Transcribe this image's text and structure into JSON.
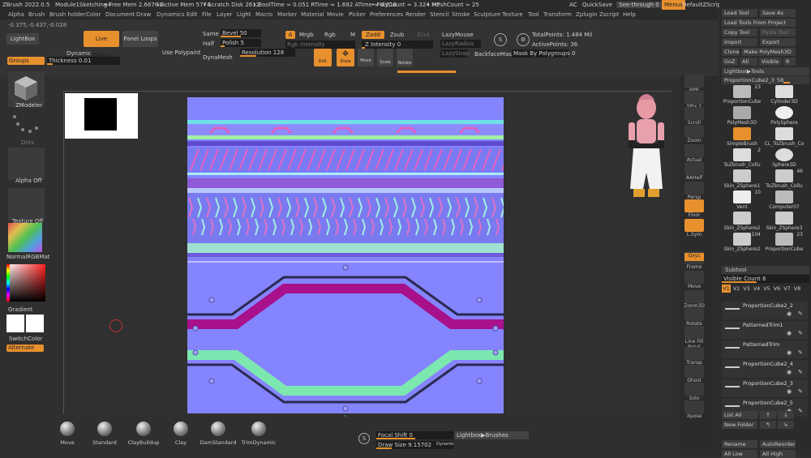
{
  "title": {
    "app": "ZBrush 2022.0.5",
    "doc": "Module1Sketching4",
    "free_mem": "• Free Mem 2.667GB",
    "active_mem": "• Active Mem 5774",
    "scratch": "• Scratch Disk 2612",
    "booltime": "• BoolTime ≈ 0.051 RTime ≈ 1.692 ATime ≈ 0.016",
    "polycount": "• PolyCount ≈ 3.324 MP",
    "meshcount": "• MeshCount ≈ 25",
    "ac": "AC",
    "quicksave": "QuickSave",
    "seethrough": "See-through 0",
    "menus": "Menus",
    "script": "DefaultZScript"
  },
  "menu": [
    "Alpha",
    "Brush",
    "Brush holder",
    "Color",
    "Document",
    "Draw",
    "Dynamics",
    "Edit",
    "File",
    "Layer",
    "Light",
    "Macro",
    "Marker",
    "Material",
    "Movie",
    "Picker",
    "Preferences",
    "Render",
    "Stencil",
    "Stroke",
    "Sculpture",
    "Texture",
    "Tool",
    "Transform",
    "Zplugin",
    "Zscript",
    "Help"
  ],
  "coords": "-0.375,-0.437,-0.028",
  "top": {
    "lightbox": "LightBox",
    "live_boolean": "Live Boolean",
    "panel_loops": "Panel Loops",
    "groups": "Groups",
    "dynamic": "Dynamic",
    "thickness": "Thickness 0.01",
    "use_polypaint": "Use Polypaint",
    "same": "Same",
    "half": "Half",
    "bevel": "Bevel 50",
    "polish": "Polish 5",
    "dynamesh": "DynaMesh",
    "resolution": "Resolution 128",
    "a": "A",
    "mrgb": "Mrgb",
    "rgb": "Rgb",
    "m": "M",
    "zadd": "Zadd",
    "zsub": "Zsub",
    "zcut": "Zcut",
    "rgb_intensity": "Rgb Intensity",
    "z_intensity": "Z Intensity 0",
    "edit": "Edit",
    "draw": "Draw",
    "move": "Move",
    "scale": "Scale",
    "rotate": "Rotate",
    "lazymouse": "LazyMouse",
    "lazyradius": "LazyRadius",
    "lazysnap": "LazySnap",
    "backfacemask": "BackfaceMask",
    "mask_by_polygroups": "Mask By Polygroups 0",
    "totalpoints": "TotalPoints: 1.484 Mil",
    "activepoints": "ActivePoints: 36"
  },
  "left": {
    "zmodeler": "ZModeler",
    "dots": "Dots",
    "alpha_off": "Alpha Off",
    "texture_off": "Texture Off",
    "normalmap": "NormalRGBMat",
    "gradient": "Gradient",
    "switchcolor": "SwitchColor",
    "alternate": "Alternate"
  },
  "right_tools": [
    "BPR",
    "SPix 2",
    "Scroll",
    "Zoom",
    "Actual",
    "AAHalf",
    "Persp",
    "Floor",
    "L.Sym",
    "Frame",
    "Move",
    "Zoom3D",
    "Rotate",
    "Line Fill PolyF",
    "Transp",
    "Ghost",
    "Solo",
    "Xpose"
  ],
  "rp": {
    "load_tool": "Load Tool",
    "save_as": "Save As",
    "load_from_project": "Load Tools From Project",
    "copy_tool": "Copy Tool",
    "paste_tool": "Paste Tool",
    "import": "Import",
    "export": "Export",
    "clone": "Clone",
    "make_polymesh": "Make PolyMesh3D",
    "goz": "GoZ",
    "all": "All",
    "visible": "Visible",
    "r": "R",
    "lightbox_tools": "Lightbox▶Tools",
    "current_tool": "ProportionCube2_3",
    "current_val": "58",
    "tools": [
      {
        "name": "ProportionCube",
        "n": "23"
      },
      {
        "name": "Cylinder3D",
        "n": ""
      },
      {
        "name": "PolyMesh3D",
        "n": ""
      },
      {
        "name": "PolySphere",
        "n": ""
      },
      {
        "name": "SimpleBrush",
        "n": ""
      },
      {
        "name": "CL_ToZbrush_Co",
        "n": ""
      },
      {
        "name": "ToZbrush_Collu",
        "n": "2"
      },
      {
        "name": "Sphere3D",
        "n": ""
      },
      {
        "name": "Skin_ZSphere1",
        "n": ""
      },
      {
        "name": "ToZbrush_Collu",
        "n": "46"
      },
      {
        "name": "Vent",
        "n": "10"
      },
      {
        "name": "Computer07",
        "n": ""
      },
      {
        "name": "Skin_ZSphere2",
        "n": ""
      },
      {
        "name": "Skin_ZSphere3",
        "n": ""
      },
      {
        "name": "Skin_ZSphere2",
        "n": "104"
      },
      {
        "name": "ProportionCube",
        "n": "23"
      }
    ],
    "subtool": "Subtool",
    "visible_count": "Visible Count 6",
    "versions": [
      "V1",
      "V2",
      "V3",
      "V4",
      "V5",
      "V6",
      "V7",
      "V8"
    ],
    "subtools": [
      "ProportionCube2_2",
      "PatternedTrim1",
      "PatternedTrim",
      "ProportionCube2_4",
      "ProportionCube2_3",
      "ProportionCube2_5"
    ],
    "list_all": "List All",
    "new_folder": "New Folder",
    "rename": "Rename",
    "autoreorder": "AutoReorder",
    "all_low": "All Low",
    "all_high": "All High"
  },
  "bottom": {
    "brushes": [
      "Move",
      "Standard",
      "ClayBuildup",
      "Clay",
      "DamStandard",
      "TrimDynamic"
    ],
    "focal_shift": "Focal Shift 0",
    "draw_size": "Draw Size 9.15702",
    "dynamic": "Dynamic",
    "lightbox_brushes": "Lightbox▶Brushes"
  },
  "colors": {
    "accent": "#e8902e",
    "normal_bg": "#8080ff"
  }
}
